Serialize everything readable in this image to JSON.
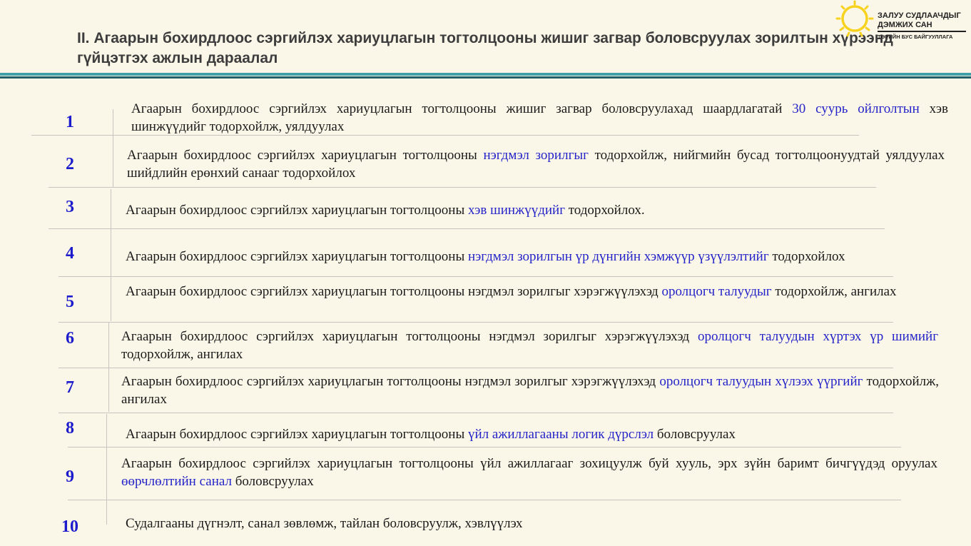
{
  "title": "II. Агаарын бохирдлоос сэргийлэх хариуцлагын тогтолцооны жишиг загвар боловсруулах зорилтын хүрээнд гүйцэтгэх ажлын дараалал",
  "logo": {
    "line1": "ЗАЛУУ СУДЛААЧДЫГ",
    "line2": "ДЭМЖИХ САН",
    "line3": "ТӨРИЙН БУС БАЙГУУЛЛАГА",
    "icon": "sun-logo-icon"
  },
  "colors": {
    "accent_bar": "#3fa0a8",
    "number": "#1c1ccc",
    "highlight": "#2424c8",
    "background": "#fbf7e8"
  },
  "steps": [
    {
      "number": "1",
      "before": "Агаарын бохирдлоос сэргийлэх хариуцлагын тогтолцооны жишиг загвар боловсруулахад шаардлагатай ",
      "highlight": "30 суурь ойлголтын",
      "after": " хэв шинжүүдийг тодорхойлж, уялдуулах"
    },
    {
      "number": "2",
      "before": "Агаарын бохирдлоос сэргийлэх хариуцлагын тогтолцооны ",
      "highlight": "нэгдмэл зорилгыг",
      "after": " тодорхойлж, нийгмийн бусад тогтолцоонуудтай уялдуулах шийдлийн ерөнхий санааг тодорхойлох"
    },
    {
      "number": "3",
      "before": "Агаарын бохирдлоос сэргийлэх хариуцлагын тогтолцооны ",
      "highlight": "хэв шинжүүдийг",
      "after": " тодорхойлох."
    },
    {
      "number": "4",
      "before": "Агаарын бохирдлоос сэргийлэх хариуцлагын тогтолцооны ",
      "highlight": "нэгдмэл зорилгын үр дүнгийн хэмжүүр үзүүлэлтийг",
      "after": " тодорхойлох"
    },
    {
      "number": "5",
      "before": "Агаарын бохирдлоос сэргийлэх хариуцлагын тогтолцооны нэгдмэл зорилгыг хэрэгжүүлэхэд ",
      "highlight": "оролцогч талуудыг",
      "after": " тодорхойлж, ангилах"
    },
    {
      "number": "6",
      "before": "Агаарын бохирдлоос сэргийлэх хариуцлагын тогтолцооны нэгдмэл зорилгыг хэрэгжүүлэхэд ",
      "highlight": "оролцогч талуудын хүртэх үр шимийг",
      "after": " тодорхойлж, ангилах"
    },
    {
      "number": "7",
      "before": "Агаарын бохирдлоос сэргийлэх хариуцлагын тогтолцооны нэгдмэл зорилгыг хэрэгжүүлэхэд ",
      "highlight": "оролцогч талуудын хүлээх үүргийг",
      "after": " тодорхойлж, ангилах"
    },
    {
      "number": "8",
      "before": "Агаарын бохирдлоос сэргийлэх хариуцлагын тогтолцооны ",
      "highlight": "үйл ажиллагааны логик дүрслэл",
      "after": " боловсруулах"
    },
    {
      "number": "9",
      "before": "Агаарын бохирдлоос сэргийлэх хариуцлагын тогтолцооны үйл ажиллагааг зохицуулж буй хууль, эрх зүйн баримт бичгүүдэд оруулах ",
      "highlight": "өөрчлөлтийн санал",
      "after": " боловсруулах"
    },
    {
      "number": "10",
      "before": "Судалгааны дүгнэлт, санал зөвлөмж, тайлан боловсруулж, хэвлүүлэх",
      "highlight": "",
      "after": ""
    }
  ]
}
